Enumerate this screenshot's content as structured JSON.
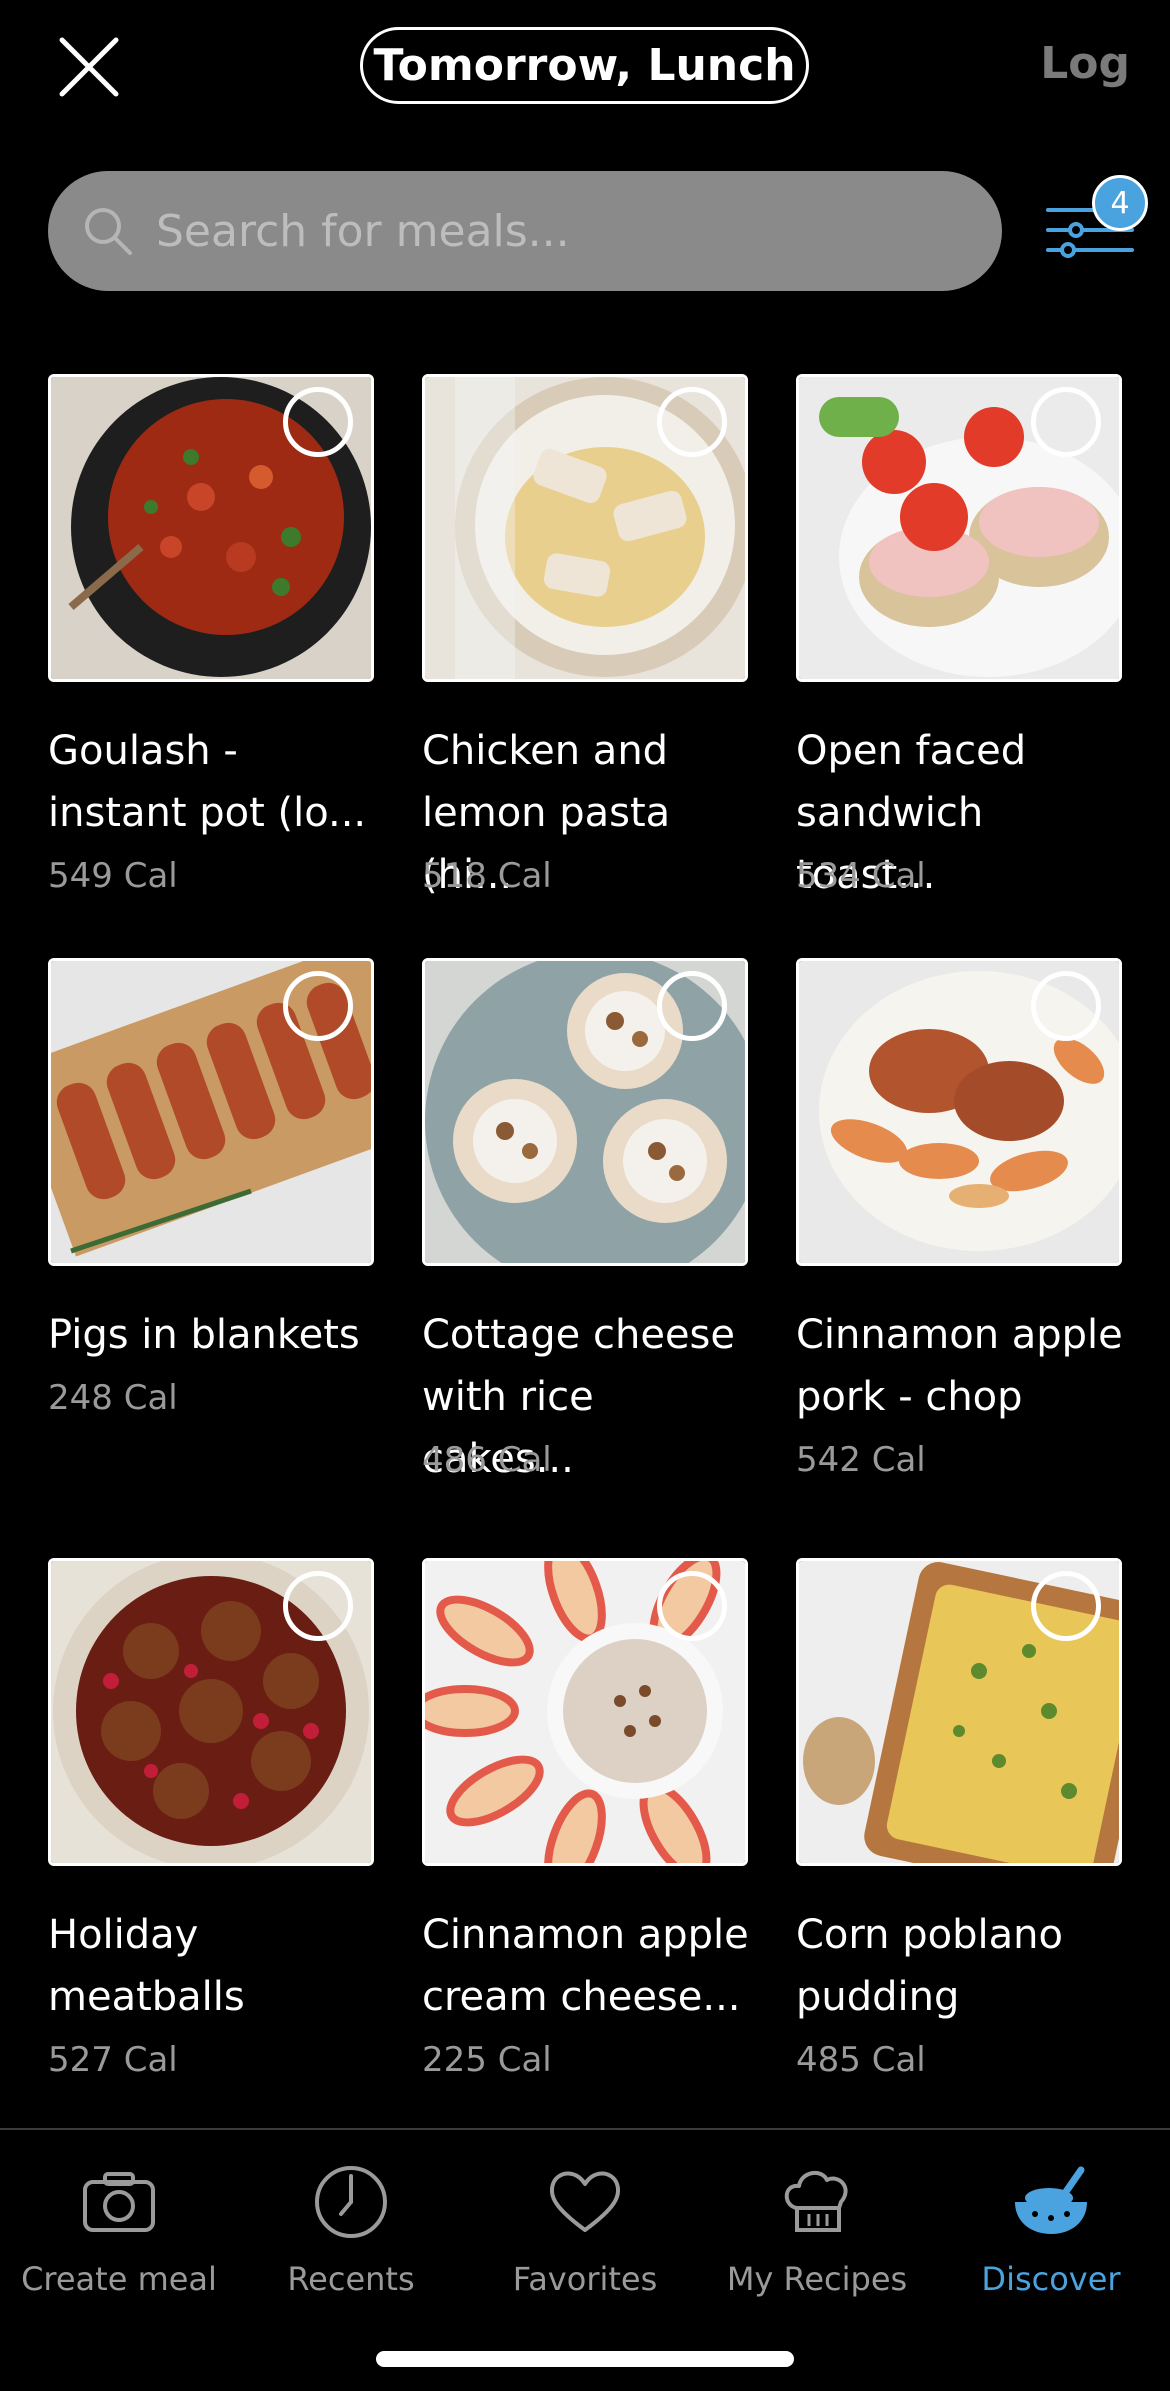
{
  "header": {
    "meal_slot": "Tomorrow, Lunch",
    "log_label": "Log"
  },
  "search": {
    "placeholder": "Search for meals..."
  },
  "filter": {
    "badge_count": "4"
  },
  "meals": [
    {
      "title": "Goulash -\ninstant pot (lo...",
      "calories": "549 Cal"
    },
    {
      "title": "Chicken and\nlemon pasta (hi...",
      "calories": "518 Cal"
    },
    {
      "title": "Open faced\nsandwich toast...",
      "calories": "534 Cal"
    },
    {
      "title": "Pigs in blankets",
      "calories": "248 Cal"
    },
    {
      "title": "Cottage cheese\nwith rice cakes...",
      "calories": "486 Cal"
    },
    {
      "title": "Cinnamon apple\npork - chop",
      "calories": "542 Cal"
    },
    {
      "title": "Holiday\nmeatballs",
      "calories": "527 Cal"
    },
    {
      "title": "Cinnamon apple\ncream cheese...",
      "calories": "225 Cal"
    },
    {
      "title": "Corn poblano\npudding",
      "calories": "485 Cal"
    }
  ],
  "nav": {
    "items": [
      {
        "label": "Create meal",
        "icon": "camera-icon"
      },
      {
        "label": "Recents",
        "icon": "clock-icon"
      },
      {
        "label": "Favorites",
        "icon": "heart-icon"
      },
      {
        "label": "My Recipes",
        "icon": "chef-hat-icon"
      },
      {
        "label": "Discover",
        "icon": "bowl-icon"
      }
    ],
    "active_index": 4
  },
  "colors": {
    "accent": "#4aa3df",
    "background": "#000000",
    "muted": "#9a9a9a",
    "search_bg": "#8a8a8a"
  }
}
